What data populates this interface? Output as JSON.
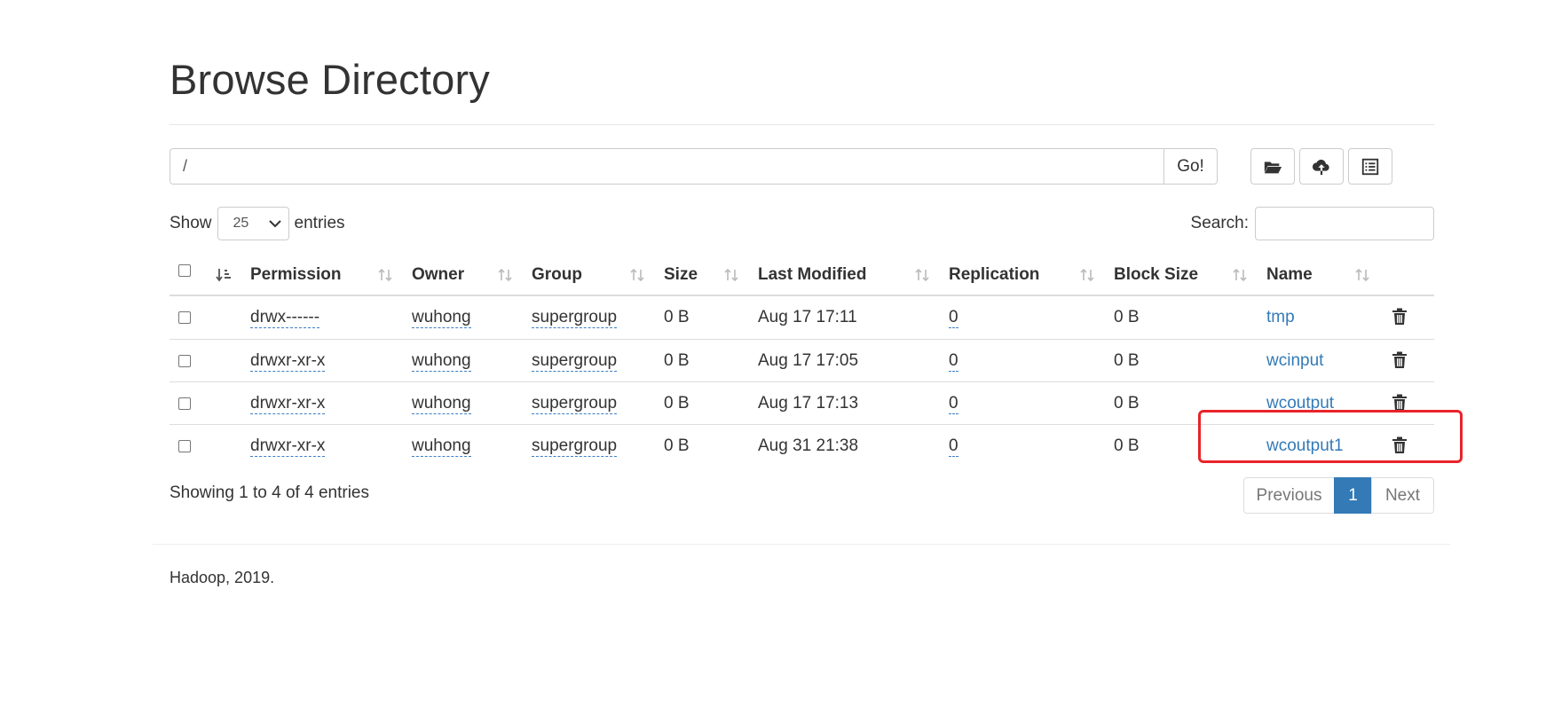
{
  "page": {
    "title": "Browse Directory"
  },
  "path_bar": {
    "value": "/",
    "go_label": "Go!"
  },
  "toolbar": {
    "create_dir_icon": "folder-open-icon",
    "upload_icon": "cloud-upload-icon",
    "utilities_icon": "list-alt-icon"
  },
  "table_controls": {
    "show_label": "Show",
    "entries_value": "25",
    "entries_label": "entries",
    "search_label": "Search:"
  },
  "columns": [
    "Permission",
    "Owner",
    "Group",
    "Size",
    "Last Modified",
    "Replication",
    "Block Size",
    "Name"
  ],
  "rows": [
    {
      "permission": "drwx------",
      "owner": "wuhong",
      "group": "supergroup",
      "size": "0 B",
      "modified": "Aug 17 17:11",
      "replication": "0",
      "block_size": "0 B",
      "name": "tmp"
    },
    {
      "permission": "drwxr-xr-x",
      "owner": "wuhong",
      "group": "supergroup",
      "size": "0 B",
      "modified": "Aug 17 17:05",
      "replication": "0",
      "block_size": "0 B",
      "name": "wcinput"
    },
    {
      "permission": "drwxr-xr-x",
      "owner": "wuhong",
      "group": "supergroup",
      "size": "0 B",
      "modified": "Aug 17 17:13",
      "replication": "0",
      "block_size": "0 B",
      "name": "wcoutput"
    },
    {
      "permission": "drwxr-xr-x",
      "owner": "wuhong",
      "group": "supergroup",
      "size": "0 B",
      "modified": "Aug 31 21:38",
      "replication": "0",
      "block_size": "0 B",
      "name": "wcoutput1"
    }
  ],
  "info": "Showing 1 to 4 of 4 entries",
  "pagination": {
    "previous": "Previous",
    "current": "1",
    "next": "Next"
  },
  "footer": "Hadoop, 2019.",
  "colors": {
    "link": "#337ab7",
    "highlight": "#e8242a"
  }
}
